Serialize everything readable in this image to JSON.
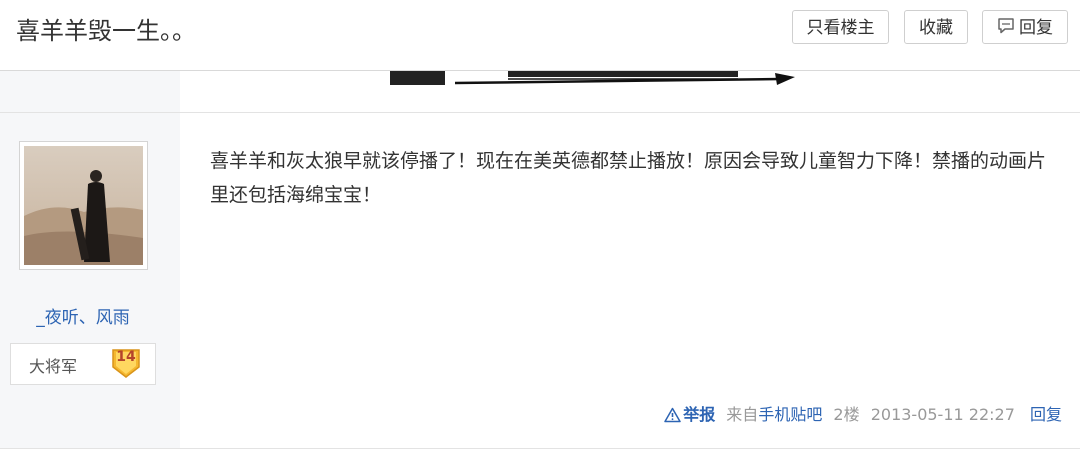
{
  "thread": {
    "title": "喜羊羊毁一生。。"
  },
  "toolbar": {
    "only_op_label": "只看楼主",
    "favorite_label": "收藏",
    "reply_label": "回复"
  },
  "post": {
    "author": {
      "username": "_夜听、风雨",
      "rank_title": "大将军",
      "level": "14"
    },
    "content": "喜羊羊和灰太狼早就该停播了！现在在美英德都禁止播放！原因会导致儿童智力下降！禁播的动画片里还包括海绵宝宝！",
    "meta": {
      "report_label": "举报",
      "source_prefix": "来自",
      "source_link": "手机贴吧",
      "floor": "2楼",
      "timestamp": "2013-05-11 22:27",
      "reply_label": "回复"
    }
  },
  "colors": {
    "link_blue": "#2d64b3",
    "sidebar_bg": "#f6f7f9",
    "badge_gold": "#f5b830"
  }
}
